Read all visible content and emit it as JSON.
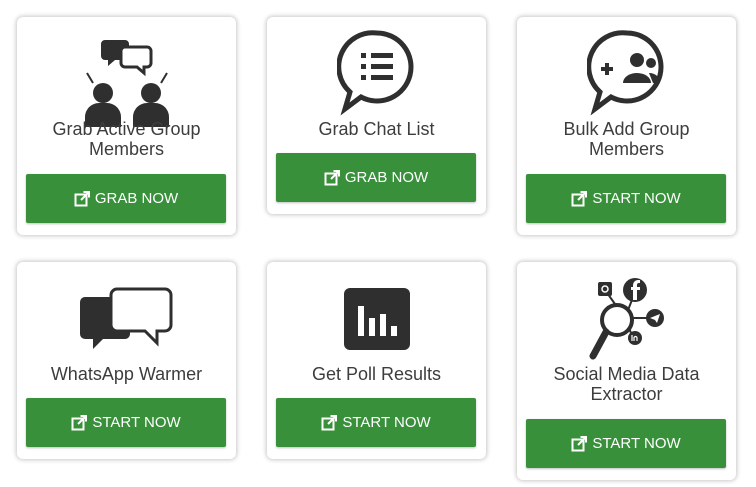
{
  "cards": [
    {
      "title": "Grab Active Group Members",
      "button": "GRAB NOW",
      "icon": "group-chat-icon"
    },
    {
      "title": "Grab Chat List",
      "button": "GRAB NOW",
      "icon": "chat-list-icon"
    },
    {
      "title": "Bulk Add Group Members",
      "button": "START NOW",
      "icon": "add-group-icon"
    },
    {
      "title": "WhatsApp Warmer",
      "button": "START NOW",
      "icon": "chat-bubbles-icon"
    },
    {
      "title": "Get Poll Results",
      "button": "START NOW",
      "icon": "bar-chart-icon"
    },
    {
      "title": "Social Media Data Extractor",
      "button": "START NOW",
      "icon": "social-extractor-icon"
    }
  ],
  "colors": {
    "button": "#38903a",
    "icon": "#333333",
    "text": "#3d3d3d"
  }
}
